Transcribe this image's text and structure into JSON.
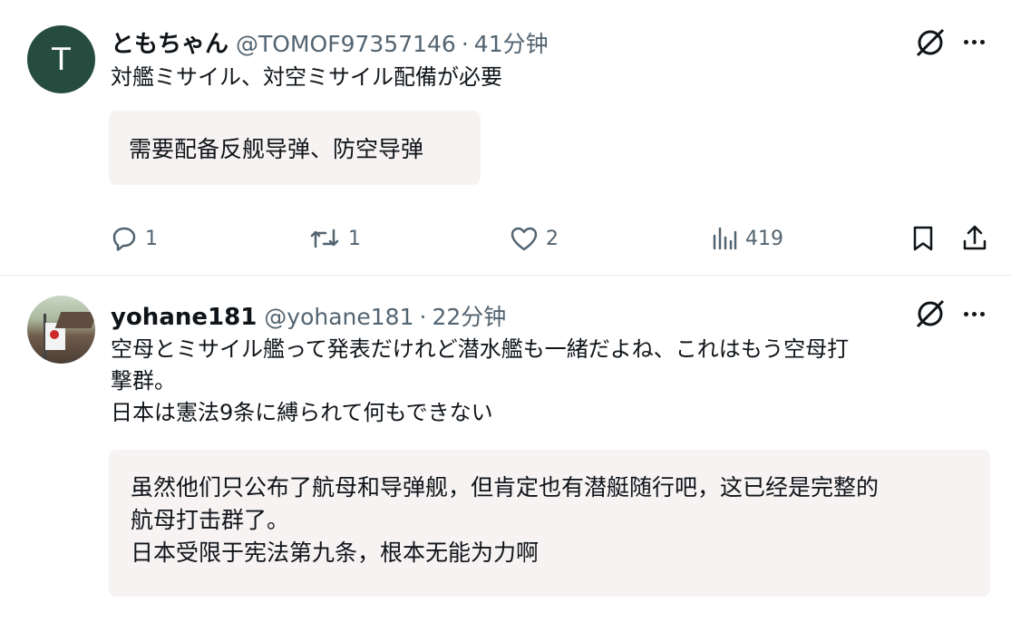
{
  "posts": [
    {
      "avatar_letter": "T",
      "avatar_color": "#254c3f",
      "display_name": "ともちゃん",
      "handle": "@TOMOF97357146",
      "separator": "·",
      "time": "41分钟",
      "text": "対艦ミサイル、対空ミサイル配備が必要",
      "translation": "需要配备反舰导弹、防空导弹",
      "stats": {
        "replies": "1",
        "reposts": "1",
        "likes": "2",
        "views": "419"
      }
    },
    {
      "avatar_letter": "",
      "display_name": "yohane181",
      "handle": "@yohane181",
      "separator": "·",
      "time": "22分钟",
      "text": "空母とミサイル艦って発表だけれど潜水艦も一緒だよね、これはもう空母打\n撃群。\n日本は憲法9条に縛られて何もできない",
      "translation": "虽然他们只公布了航母和导弹舰，但肯定也有潜艇随行吧，这已经是完整的\n航母打击群了。\n日本受限于宪法第九条，根本无能为力啊"
    }
  ],
  "icons": {
    "grok": "grok-icon",
    "more": "more-icon",
    "reply": "reply-icon",
    "repost": "repost-icon",
    "like": "like-icon",
    "views": "views-icon",
    "bookmark": "bookmark-icon",
    "share": "share-icon"
  },
  "colors": {
    "text": "#0f1419",
    "secondary": "#536471",
    "translation_bg": "#f7f3f3"
  }
}
